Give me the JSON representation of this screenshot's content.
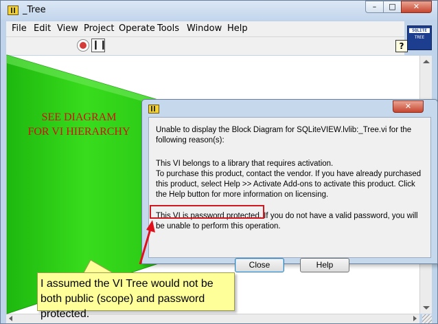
{
  "window": {
    "title": "_Tree",
    "controls": {
      "minimize": "–",
      "maximize": "□",
      "close": "✕"
    }
  },
  "menubar": {
    "items": [
      "File",
      "Edit",
      "View",
      "Project",
      "Operate",
      "Tools",
      "Window",
      "Help"
    ]
  },
  "toolbar": {
    "help_glyph": "?",
    "pause_glyph": "❙❙"
  },
  "vi_icon": {
    "line1": "SQLITE",
    "line2": "TREE"
  },
  "diagram": {
    "text_line1": "SEE DIAGRAM",
    "text_line2": "FOR VI HIERARCHY",
    "fill_color": "#2ecc16"
  },
  "dialog": {
    "close_glyph": "✕",
    "message1": "Unable to display the Block Diagram for SQLiteVIEW.lvlib:_Tree.vi for the following reason(s):",
    "message2": "This VI belongs to a library that requires activation.\nTo purchase this product, contact the vendor.  If you have already purchased this product, select Help >> Activate Add-ons to activate this product.  Click the Help button for more information on licensing.",
    "message3_highlight": "This VI is password protected.",
    "message3_rest": " If you do not have a valid password, you will be unable to perform this operation.",
    "close_label": "Close",
    "help_label": "Help"
  },
  "callout": {
    "text": "I assumed the VI Tree would not be both public (scope) and password protected.",
    "arrow_color": "#e0101a",
    "box_color": "#ffff99"
  }
}
